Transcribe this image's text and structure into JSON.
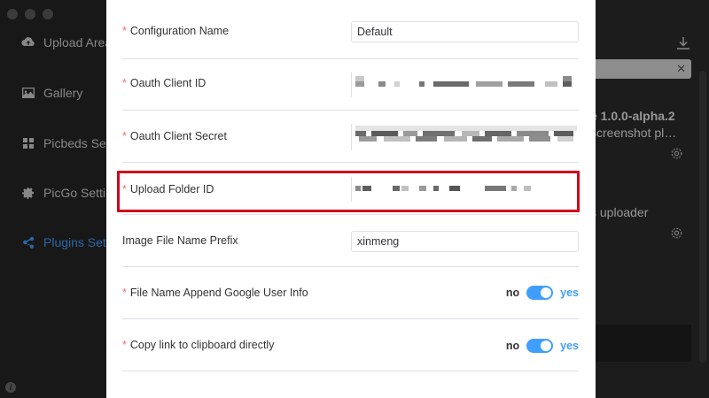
{
  "sidebar": {
    "items": [
      {
        "label": "Upload Area",
        "icon": "cloud-upload-icon"
      },
      {
        "label": "Gallery",
        "icon": "image-icon"
      },
      {
        "label": "Picbeds Settings",
        "icon": "grid-icon"
      },
      {
        "label": "PicGo Settings",
        "icon": "gear-icon"
      },
      {
        "label": "Plugins Settings",
        "icon": "share-icon",
        "active": true
      }
    ]
  },
  "plugins": {
    "version_text": "e 1.0.0-alpha.2",
    "desc_text": "screenshot pl…",
    "uploader_text": "s uploader",
    "search_clear": "✕"
  },
  "form": {
    "fields": [
      {
        "label": "Configuration Name",
        "required": true,
        "value": "Default",
        "type": "text"
      },
      {
        "label": "Oauth Client ID",
        "required": true,
        "type": "masked"
      },
      {
        "label": "Oauth Client Secret",
        "required": true,
        "type": "masked"
      },
      {
        "label": "Upload Folder ID",
        "required": true,
        "type": "masked"
      },
      {
        "label": "Image File Name Prefix",
        "required": false,
        "value": "xinmeng",
        "type": "text"
      },
      {
        "label": "File Name Append Google User Info",
        "required": true,
        "type": "switch",
        "off_label": "no",
        "on_label": "yes",
        "checked": true
      },
      {
        "label": "Copy link to clipboard directly",
        "required": true,
        "type": "switch",
        "off_label": "no",
        "on_label": "yes",
        "checked": true
      }
    ],
    "required_mark": "*"
  },
  "colors": {
    "accent": "#409eff",
    "required": "#f56c6c",
    "highlight": "#d0021b"
  }
}
